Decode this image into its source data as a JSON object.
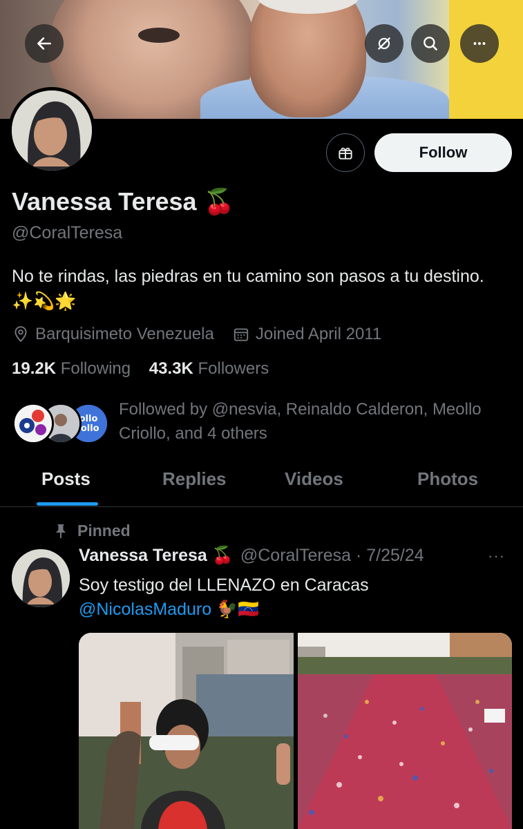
{
  "header": {
    "back_icon": "arrow-left-icon",
    "grok_icon": "grok-slash-icon",
    "search_icon": "search-icon",
    "more_icon": "more-horizontal-icon"
  },
  "profile": {
    "name": "Vanessa Teresa 🍒",
    "handle": "@CoralTeresa",
    "bio": "No te rindas, las piedras en tu camino son pasos a tu destino. ✨💫🌟",
    "location": "Barquisimeto Venezuela",
    "joined": "Joined April 2011",
    "following_count": "19.2K",
    "following_label": "Following",
    "followers_count": "43.3K",
    "followers_label": "Followers",
    "followed_by": "Followed by @nesvia, Reinaldo Calderon, Meollo Criollo, and 4 others",
    "follow_label": "Follow",
    "gift_icon": "gift-icon"
  },
  "tabs": [
    {
      "label": "Posts",
      "active": true
    },
    {
      "label": "Replies",
      "active": false
    },
    {
      "label": "Videos",
      "active": false
    },
    {
      "label": "Photos",
      "active": false
    }
  ],
  "post": {
    "pinned_label": "Pinned",
    "author_name": "Vanessa Teresa 🍒",
    "author_handle": "@CoralTeresa · 7/25/24",
    "more": "···",
    "text": "Soy testigo del LLENAZO en Caracas",
    "mention": "@NicolasMaduro",
    "emoji": " 🐓🇻🇪"
  },
  "colors": {
    "accent": "#1d9bf0",
    "secondary_text": "#71767b",
    "primary_text": "#e7e9ea",
    "background": "#000000"
  }
}
